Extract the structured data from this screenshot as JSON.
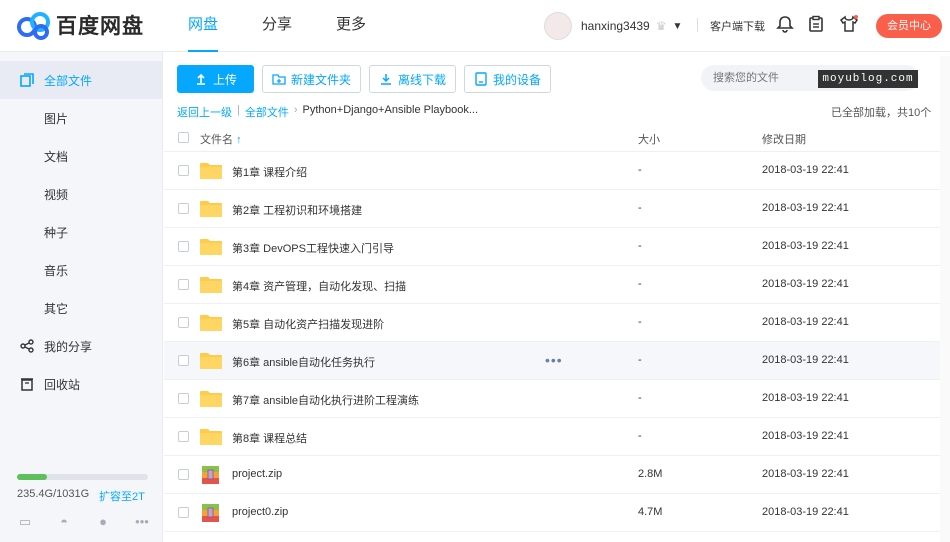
{
  "header": {
    "logo_text": "百度网盘",
    "nav": [
      {
        "label": "网盘",
        "active": true
      },
      {
        "label": "分享",
        "active": false
      },
      {
        "label": "更多",
        "active": false
      }
    ],
    "username": "hanxing3439",
    "client_download": "客户端下载",
    "vip_center": "会员中心"
  },
  "sidebar": {
    "items": [
      {
        "label": "全部文件",
        "active": true,
        "icon": "files-icon"
      },
      {
        "label": "图片"
      },
      {
        "label": "文档"
      },
      {
        "label": "视频"
      },
      {
        "label": "种子"
      },
      {
        "label": "音乐"
      },
      {
        "label": "其它"
      },
      {
        "label": "我的分享",
        "icon": "share-icon"
      },
      {
        "label": "回收站",
        "icon": "trash-icon"
      }
    ],
    "storage_used": 0.228,
    "storage_text": "235.4G/1031G",
    "expand_label": "扩容至2T"
  },
  "toolbar": {
    "upload": "上传",
    "new_folder": "新建文件夹",
    "offline_download": "离线下载",
    "my_devices": "我的设备"
  },
  "search": {
    "placeholder": "搜索您的文件"
  },
  "watermark": "moyublog.com",
  "breadcrumb": {
    "back": "返回上一级",
    "all": "全部文件",
    "current": "Python+Django+Ansible Playbook..."
  },
  "loaded_text": "已全部加载，共10个",
  "table": {
    "col_name": "文件名",
    "col_size": "大小",
    "col_date": "修改日期",
    "rows": [
      {
        "name": "第1章 课程介绍",
        "size": "-",
        "date": "2018-03-19 22:41",
        "type": "folder"
      },
      {
        "name": "第2章 工程初识和环境搭建",
        "size": "-",
        "date": "2018-03-19 22:41",
        "type": "folder"
      },
      {
        "name": "第3章 DevOPS工程快速入门引导",
        "size": "-",
        "date": "2018-03-19 22:41",
        "type": "folder"
      },
      {
        "name": "第4章 资产管理，自动化发现、扫描",
        "size": "-",
        "date": "2018-03-19 22:41",
        "type": "folder"
      },
      {
        "name": "第5章 自动化资产扫描发现进阶",
        "size": "-",
        "date": "2018-03-19 22:41",
        "type": "folder"
      },
      {
        "name": "第6章 ansible自动化任务执行",
        "size": "-",
        "date": "2018-03-19 22:41",
        "type": "folder"
      },
      {
        "name": "第7章 ansible自动化执行进阶工程演练",
        "size": "-",
        "date": "2018-03-19 22:41",
        "type": "folder"
      },
      {
        "name": "第8章 课程总结",
        "size": "-",
        "date": "2018-03-19 22:41",
        "type": "folder"
      },
      {
        "name": "project.zip",
        "size": "2.8M",
        "date": "2018-03-19 22:41",
        "type": "zip"
      },
      {
        "name": "project0.zip",
        "size": "4.7M",
        "date": "2018-03-19 22:41",
        "type": "zip"
      }
    ]
  },
  "colors": {
    "accent": "#06a7ff",
    "vip": "#f95f4a",
    "folder": "#ffcb4c"
  }
}
